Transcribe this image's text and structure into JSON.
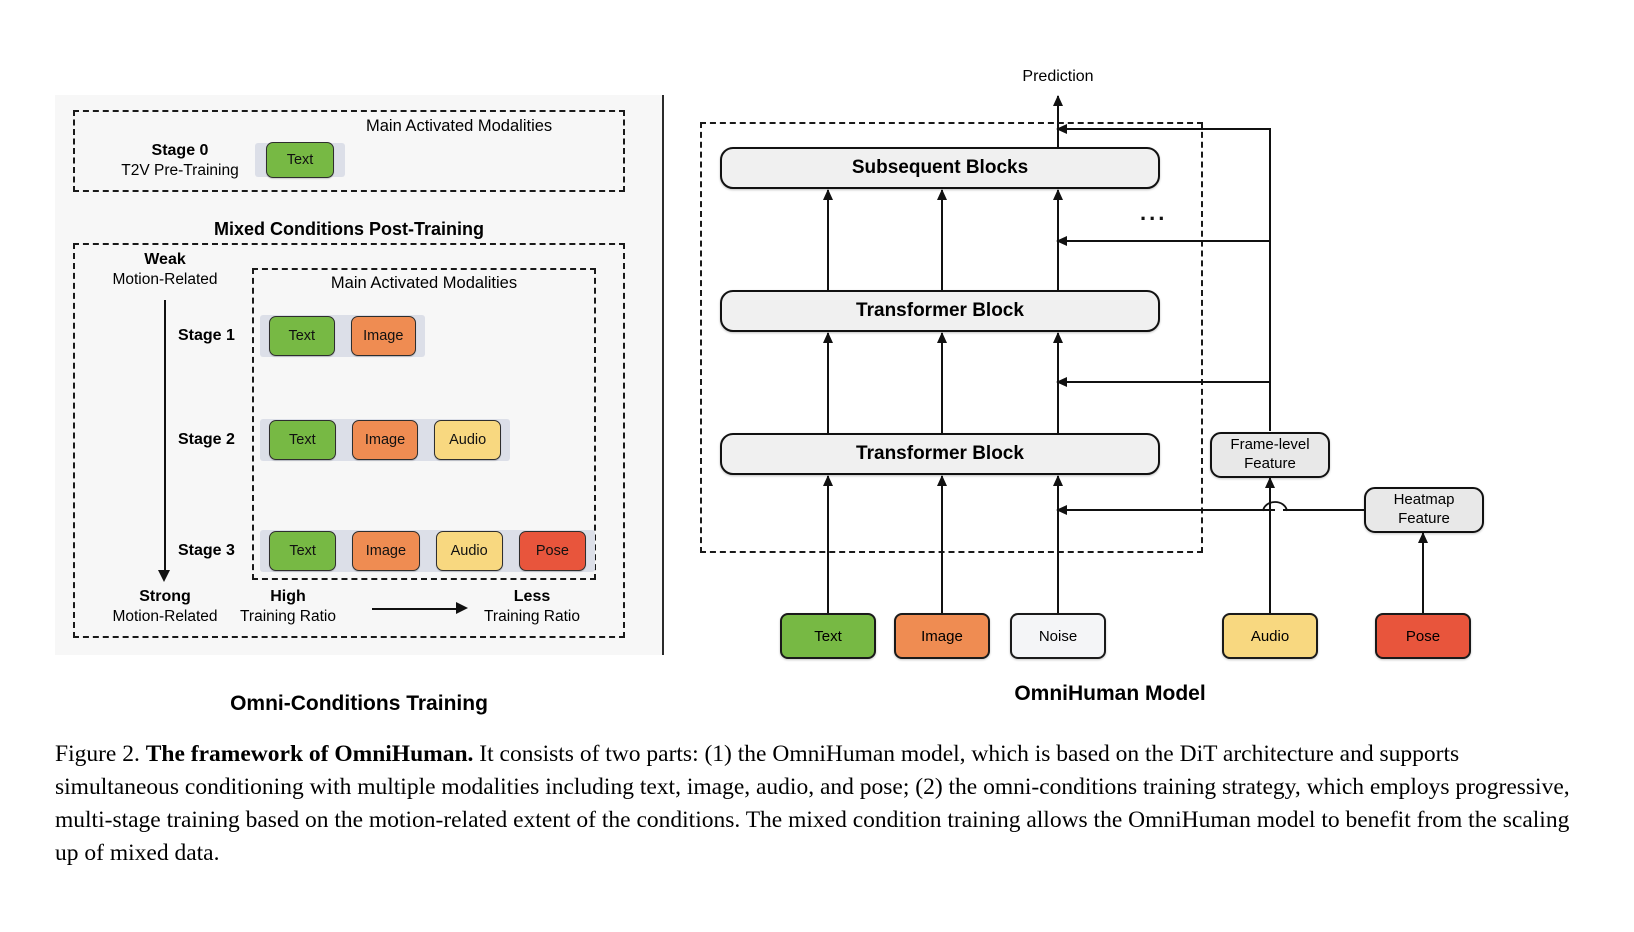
{
  "figure": {
    "caption_prefix": "Figure 2.",
    "caption_bold": "The framework of OmniHuman.",
    "caption_rest": "It consists of two parts: (1) the OmniHuman model, which is based on the DiT architecture and supports simultaneous conditioning with multiple modalities including text, image, audio, and pose; (2) the omni-conditions training strategy, which employs progressive, multi-stage training based on the motion-related extent of the conditions. The mixed condition training allows the OmniHuman model to benefit from the scaling up of mixed data."
  },
  "left": {
    "section_label": "Omni-Conditions Training",
    "stage0": {
      "title": "Stage 0",
      "subtitle": "T2V Pre-Training",
      "modalities_header": "Main Activated Modalities",
      "chips": [
        "Text"
      ]
    },
    "post_training_title": "Mixed Conditions Post-Training",
    "axis": {
      "top_bold": "Weak",
      "top_sub": "Motion-Related",
      "bottom_bold": "Strong",
      "bottom_sub": "Motion-Related"
    },
    "ratio": {
      "left_bold": "High",
      "left_sub": "Training Ratio",
      "right_bold": "Less",
      "right_sub": "Training Ratio"
    },
    "modalities_header": "Main Activated Modalities",
    "stages": [
      {
        "label": "Stage 1",
        "chips": [
          "Text",
          "Image"
        ]
      },
      {
        "label": "Stage 2",
        "chips": [
          "Text",
          "Image",
          "Audio"
        ]
      },
      {
        "label": "Stage 3",
        "chips": [
          "Text",
          "Image",
          "Audio",
          "Pose"
        ]
      }
    ]
  },
  "right": {
    "section_label": "OmniHuman Model",
    "prediction_label": "Prediction",
    "ellipsis": "...",
    "blocks": [
      {
        "label": "Subsequent Blocks"
      },
      {
        "label": "Transformer Block"
      },
      {
        "label": "Transformer Block"
      }
    ],
    "features": [
      {
        "line1": "Frame-level",
        "line2": "Feature"
      },
      {
        "line1": "Heatmap",
        "line2": "Feature"
      }
    ],
    "inputs": [
      {
        "label": "Text",
        "kind": "text"
      },
      {
        "label": "Image",
        "kind": "image"
      },
      {
        "label": "Noise",
        "kind": "noise"
      },
      {
        "label": "Audio",
        "kind": "audio"
      },
      {
        "label": "Pose",
        "kind": "pose"
      }
    ]
  },
  "colors": {
    "text": "#77b944",
    "image": "#ef8c52",
    "audio": "#f8d880",
    "pose": "#e8553c",
    "noise": "#f4f5f7",
    "strip": "#dcdfe8",
    "panel": "#f7f7f7",
    "block": "#f0f0f0"
  }
}
